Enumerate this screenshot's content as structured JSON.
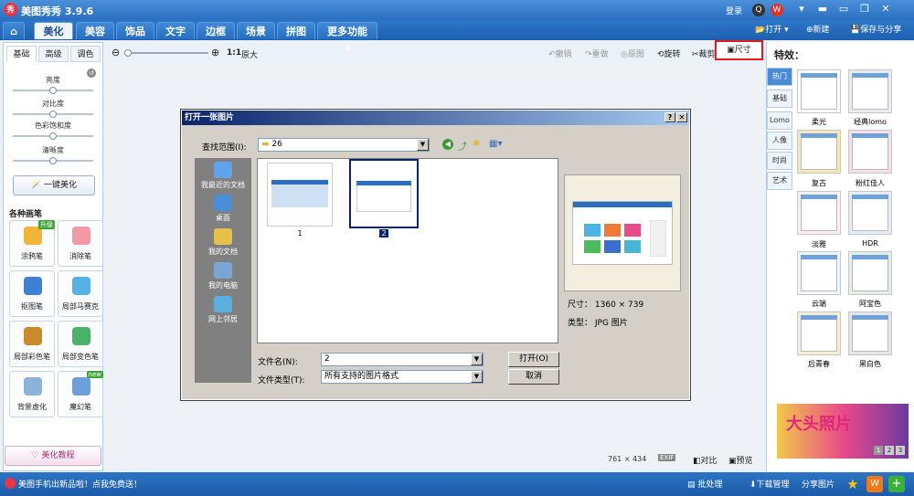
{
  "app": {
    "logo_text": "秀",
    "title": "美图秀秀 3.9.6",
    "login": "登录"
  },
  "window": {
    "minimize": "▬",
    "maximize": "▭",
    "close": "✕"
  },
  "menu": {
    "tabs": [
      "美化",
      "美容",
      "饰品",
      "文字",
      "边框",
      "场景",
      "拼图",
      "更多功能 ▾"
    ],
    "active": "美化",
    "open": "打开",
    "new": "新建",
    "save_share": "保存与分享"
  },
  "toolbar": {
    "undo": "撤销",
    "redo": "重做",
    "original": "原图",
    "rotate": "旋转",
    "crop": "裁剪",
    "size": "尺寸",
    "zoom_ratio": "1:1",
    "zoom_label": "原大"
  },
  "left_panel": {
    "tabs": [
      "基础",
      "高级",
      "调色"
    ],
    "sliders": [
      {
        "label": "亮度",
        "value": 0.5
      },
      {
        "label": "对比度",
        "value": 0.5
      },
      {
        "label": "色彩饱和度",
        "value": 0.5
      },
      {
        "label": "清晰度",
        "value": 0.5
      }
    ],
    "one_key": "一键美化",
    "brushes_title": "各种画笔",
    "brushes": [
      {
        "label": "涂鸦笔",
        "badge": "升级",
        "color": "#f0b43a"
      },
      {
        "label": "消除笔",
        "badge": "",
        "color": "#f19aa6"
      },
      {
        "label": "抠图笔",
        "badge": "",
        "color": "#3f7fd1"
      },
      {
        "label": "局部马赛克",
        "badge": "",
        "color": "#55b2e6"
      },
      {
        "label": "局部彩色笔",
        "badge": "",
        "color": "#c88a2a"
      },
      {
        "label": "局部变色笔",
        "badge": "",
        "color": "#4cb46a"
      },
      {
        "label": "背景虚化",
        "badge": "",
        "color": "#8bb3d9"
      },
      {
        "label": "魔幻笔",
        "badge": "new",
        "color": "#6d9fdb"
      }
    ],
    "tutorial": "美化教程"
  },
  "dialog": {
    "title": "打开一张图片",
    "help": "?",
    "close": "✕",
    "look_in_label": "查找范围(I):",
    "look_in_value": "26",
    "places": [
      "我最近的文档",
      "桌面",
      "我的文档",
      "我的电脑",
      "网上邻居"
    ],
    "files": [
      {
        "name": "1",
        "selected": false
      },
      {
        "name": "2",
        "selected": true
      }
    ],
    "filename_label": "文件名(N):",
    "filename_value": "2",
    "filetype_label": "文件类型(T):",
    "filetype_value": "所有支持的图片格式",
    "open_button": "打开(O)",
    "cancel_button": "取消",
    "size_label": "尺寸：",
    "size_value": "1360 × 739",
    "type_label": "类型：",
    "type_value": "JPG 图片"
  },
  "right_panel": {
    "title": "特效：",
    "tabs": [
      "热门",
      "基础",
      "Lomo",
      "人像",
      "时尚",
      "艺术"
    ],
    "active_tab": "热门",
    "effects": [
      {
        "label": "柔光",
        "bg": "#ffffff"
      },
      {
        "label": "经典lomo",
        "bg": "#e9edf2"
      },
      {
        "label": "复古",
        "bg": "#f5e7b8"
      },
      {
        "label": "粉红佳人",
        "bg": "#f6dde6"
      },
      {
        "label": "淡雅",
        "bg": "#fbeef0"
      },
      {
        "label": "HDR",
        "bg": "#e4ecf5"
      },
      {
        "label": "云端",
        "bg": "#eef5fb"
      },
      {
        "label": "阿宝色",
        "bg": "#e3f0e8"
      },
      {
        "label": "后青春",
        "bg": "#f6efd3"
      },
      {
        "label": "黑白色",
        "bg": "#e6e6e6"
      }
    ],
    "ad_text": "大头照片",
    "ad_pages": [
      "1",
      "2",
      "3"
    ]
  },
  "canvas": {
    "dims": "761 × 434",
    "exif": "EXIF",
    "compare": "对比",
    "preview": "预览"
  },
  "statusbar": {
    "news": "美图手机出新品啦！点我免费送！",
    "batch": "批处理",
    "download": "下载管理",
    "share": "分享图片"
  }
}
